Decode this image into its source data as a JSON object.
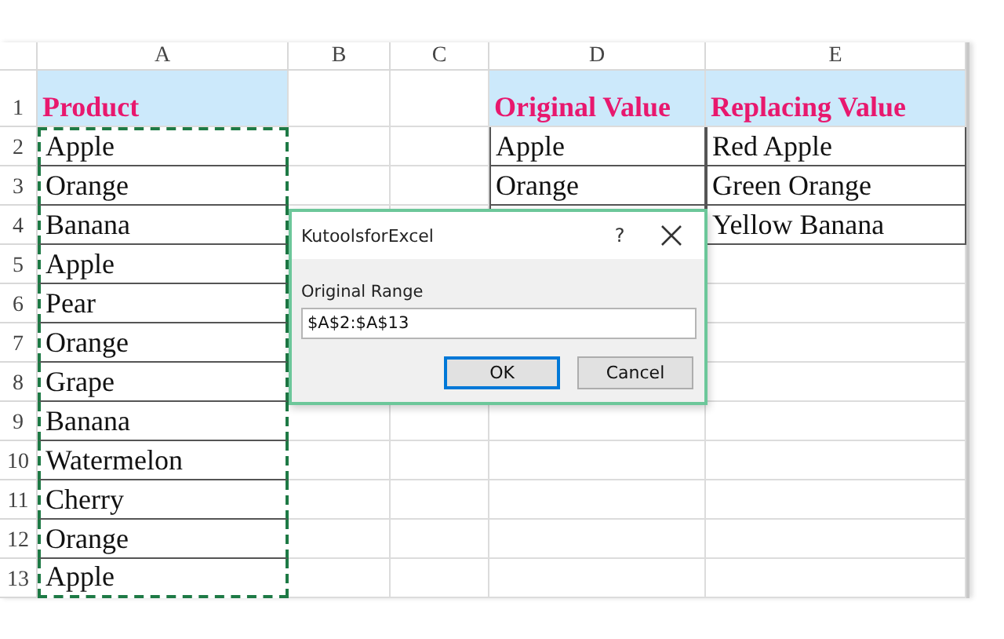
{
  "sheet": {
    "columns": [
      "A",
      "B",
      "C",
      "D",
      "E"
    ],
    "rows": [
      {
        "number": "1",
        "cells": [
          {
            "text": "Product",
            "kind": "heading",
            "marked": false
          },
          null,
          null,
          {
            "text": "Original Value",
            "kind": "heading",
            "marked": false
          },
          {
            "text": "Replacing Value",
            "kind": "heading",
            "marked": false
          }
        ]
      },
      {
        "number": "2",
        "cells": [
          {
            "text": "Apple",
            "kind": "value",
            "marked": true
          },
          null,
          null,
          {
            "text": "Apple",
            "kind": "value",
            "marked": false
          },
          {
            "text": "Red Apple",
            "kind": "value",
            "marked": false
          }
        ]
      },
      {
        "number": "3",
        "cells": [
          {
            "text": "Orange",
            "kind": "value",
            "marked": true
          },
          null,
          null,
          {
            "text": "Orange",
            "kind": "value",
            "marked": false
          },
          {
            "text": "Green Orange",
            "kind": "value",
            "marked": false
          }
        ]
      },
      {
        "number": "4",
        "cells": [
          {
            "text": "Banana",
            "kind": "value",
            "marked": true
          },
          null,
          null,
          {
            "kind": "value",
            "marked": false
          },
          {
            "text": "Yellow Banana",
            "kind": "value",
            "marked": false
          }
        ]
      },
      {
        "number": "5",
        "cells": [
          {
            "text": "Apple",
            "kind": "value",
            "marked": true
          },
          null,
          null,
          null,
          null
        ]
      },
      {
        "number": "6",
        "cells": [
          {
            "text": "Pear",
            "kind": "value",
            "marked": true
          },
          null,
          null,
          null,
          null
        ]
      },
      {
        "number": "7",
        "cells": [
          {
            "text": "Orange",
            "kind": "value",
            "marked": true
          },
          null,
          null,
          null,
          null
        ]
      },
      {
        "number": "8",
        "cells": [
          {
            "text": "Grape",
            "kind": "value",
            "marked": true
          },
          null,
          null,
          null,
          null
        ]
      },
      {
        "number": "9",
        "cells": [
          {
            "text": "Banana",
            "kind": "value",
            "marked": true
          },
          null,
          null,
          null,
          null
        ]
      },
      {
        "number": "10",
        "cells": [
          {
            "text": "Watermelon",
            "kind": "value",
            "marked": true
          },
          null,
          null,
          null,
          null
        ]
      },
      {
        "number": "11",
        "cells": [
          {
            "text": "Cherry",
            "kind": "value",
            "marked": true
          },
          null,
          null,
          null,
          null
        ]
      },
      {
        "number": "12",
        "cells": [
          {
            "text": "Orange",
            "kind": "value",
            "marked": true
          },
          null,
          null,
          null,
          null
        ]
      },
      {
        "number": "13",
        "cells": [
          {
            "text": "Apple",
            "kind": "value",
            "marked": true
          },
          null,
          null,
          null,
          null
        ]
      }
    ]
  },
  "dialog": {
    "title": "KutoolsforExcel",
    "help": "?",
    "field_label": "Original Range",
    "field_value": "$A$2:$A$13",
    "buttons": [
      {
        "label": "OK",
        "default": true
      },
      {
        "label": "Cancel",
        "default": false
      }
    ]
  }
}
